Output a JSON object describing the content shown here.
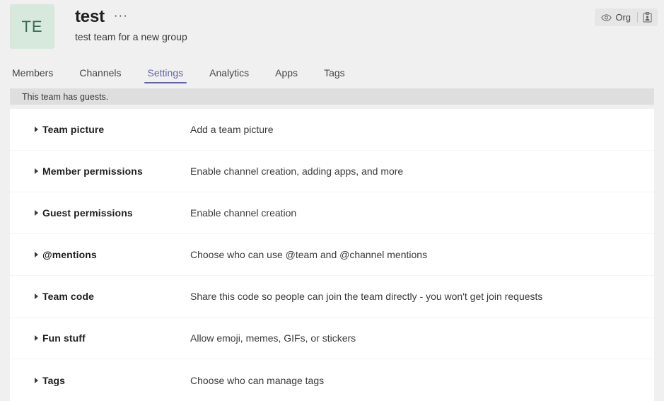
{
  "header": {
    "avatar_initials": "TE",
    "avatar_color": "#d7e8dc",
    "team_name": "test",
    "more_options_label": "···",
    "team_description": "test team for a new group",
    "org_badge": {
      "eye_icon": "eye-icon",
      "label": "Org",
      "clipboard_icon": "clipboard-person-icon"
    }
  },
  "tabs": {
    "accent_color": "#6264a7",
    "items": [
      {
        "label": "Members",
        "active": false
      },
      {
        "label": "Channels",
        "active": false
      },
      {
        "label": "Settings",
        "active": true
      },
      {
        "label": "Analytics",
        "active": false
      },
      {
        "label": "Apps",
        "active": false
      },
      {
        "label": "Tags",
        "active": false
      }
    ]
  },
  "notice": {
    "text": "This team has guests.",
    "background": "#dedede"
  },
  "settings": {
    "rows": [
      {
        "name": "Team picture",
        "description": "Add a team picture",
        "expand_icon": "chevron-right-icon"
      },
      {
        "name": "Member permissions",
        "description": "Enable channel creation, adding apps, and more",
        "expand_icon": "chevron-right-icon"
      },
      {
        "name": "Guest permissions",
        "description": "Enable channel creation",
        "expand_icon": "chevron-right-icon"
      },
      {
        "name": "@mentions",
        "description": "Choose who can use @team and @channel mentions",
        "expand_icon": "chevron-right-icon"
      },
      {
        "name": "Team code",
        "description": "Share this code so people can join the team directly - you won't get join requests",
        "expand_icon": "chevron-right-icon"
      },
      {
        "name": "Fun stuff",
        "description": "Allow emoji, memes, GIFs, or stickers",
        "expand_icon": "chevron-right-icon"
      },
      {
        "name": "Tags",
        "description": "Choose who can manage tags",
        "expand_icon": "chevron-right-icon"
      }
    ]
  }
}
